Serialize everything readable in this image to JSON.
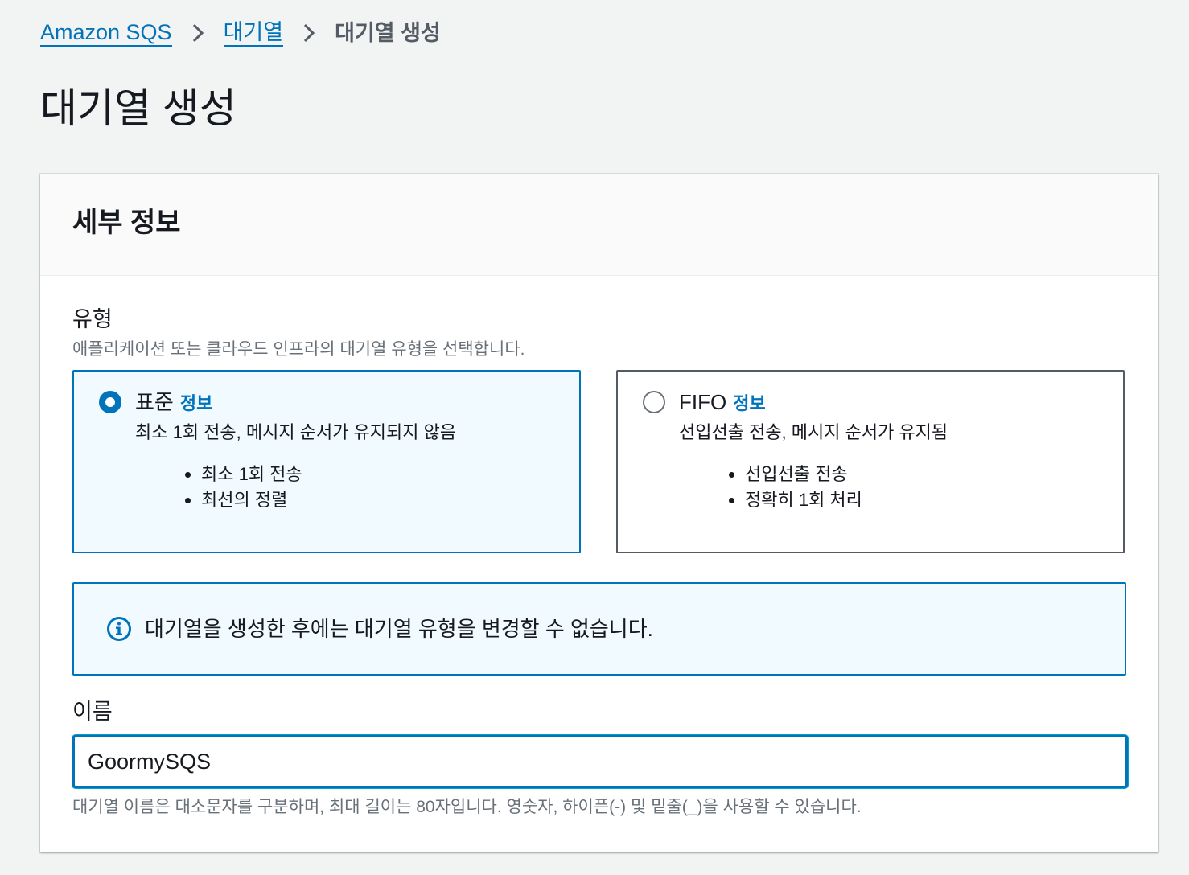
{
  "breadcrumb": {
    "items": [
      "Amazon SQS",
      "대기열"
    ],
    "current": "대기열 생성"
  },
  "page": {
    "title": "대기열 생성"
  },
  "details": {
    "title": "세부 정보",
    "type": {
      "label": "유형",
      "description": "애플리케이션 또는 클라우드 인프라의 대기열 유형을 선택합니다.",
      "selected": "standard",
      "options": [
        {
          "title": "표준",
          "info": "정보",
          "description": "최소 1회 전송, 메시지 순서가 유지되지 않음",
          "bullets": [
            "최소 1회 전송",
            "최선의 정렬"
          ]
        },
        {
          "title": "FIFO",
          "info": "정보",
          "description": "선입선출 전송, 메시지 순서가 유지됨",
          "bullets": [
            "선입선출 전송",
            "정확히 1회 처리"
          ]
        }
      ]
    },
    "alert": {
      "icon": "info-icon",
      "text": "대기열을 생성한 후에는 대기열 유형을 변경할 수 없습니다."
    },
    "name": {
      "label": "이름",
      "value": "GoormySQS",
      "constraint": "대기열 이름은 대소문자를 구분하며, 최대 길이는 80자입니다. 영숫자, 하이픈(-) 및 밑줄(_)을 사용할 수 있습니다."
    }
  },
  "colors": {
    "link": "#0073bb",
    "selected_bg": "#f1faff",
    "page_bg": "#f2f3f3",
    "secondary_text": "#687078"
  }
}
